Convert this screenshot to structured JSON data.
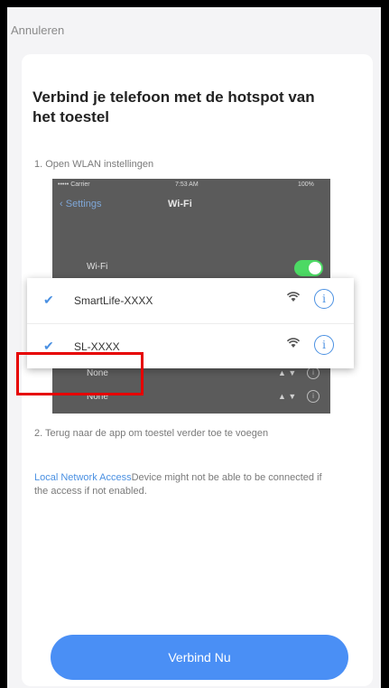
{
  "header": {
    "cancel_label": "Annuleren"
  },
  "main": {
    "title": "Verbind je telefoon met de hotspot van het toestel",
    "step1": "1. Open WLAN instellingen",
    "step2": "2. Terug naar de app om toestel verder toe te voegen",
    "link_text": "Local Network Access",
    "link_suffix": "Device might not be able to be connected if the access if not enabled.",
    "connect_button": "Verbind Nu"
  },
  "phone": {
    "carrier": "••••• Carrier",
    "time": "7:53 AM",
    "battery": "100%",
    "back_label": "Settings",
    "wifi_title": "Wi-Fi",
    "wifi_label": "Wi-Fi",
    "other_rows": [
      "None",
      "None"
    ]
  },
  "networks": [
    {
      "name": "SmartLife-XXXX"
    },
    {
      "name": "SL-XXXX"
    }
  ],
  "colors": {
    "accent": "#4a90e2",
    "button": "#4a8ff5",
    "toggle": "#4cd964",
    "highlight": "#e60000"
  }
}
